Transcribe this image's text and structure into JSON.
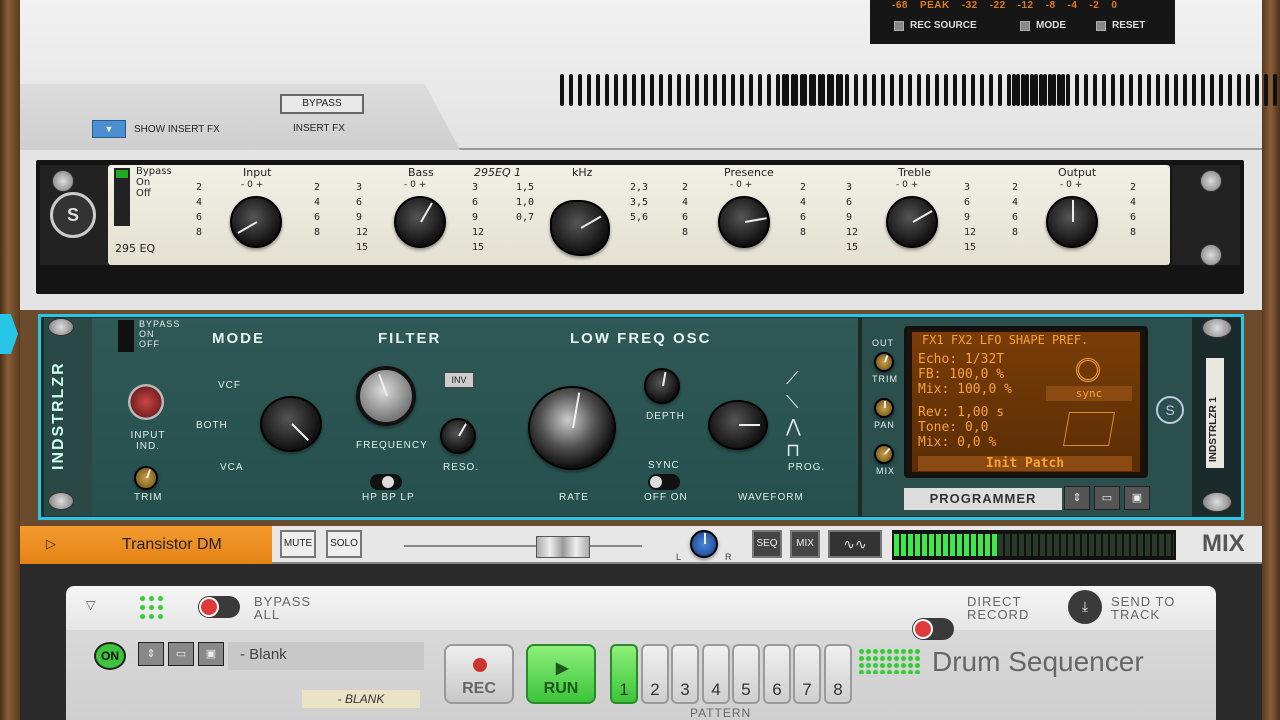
{
  "top_device": {
    "meter_scale": [
      "-68",
      "PEAK",
      "-32",
      "-22",
      "-12",
      "-8",
      "-4",
      "-2",
      "0"
    ],
    "rec_source_label": "REC SOURCE",
    "mode_label": "MODE",
    "reset_label": "RESET",
    "bypass_label": "BYPASS",
    "insert_fx_label": "INSERT FX",
    "show_insert_fx_label": "SHOW INSERT FX"
  },
  "eq": {
    "name": "295 EQ",
    "patch_note": "295EQ 1",
    "bypass_labels": [
      "Bypass",
      "On",
      "Off"
    ],
    "knobs": [
      {
        "label": "Input",
        "top": "- 0 +",
        "left": [
          "2",
          "4",
          "6",
          "8"
        ],
        "right": [
          "2",
          "4",
          "6",
          "8"
        ]
      },
      {
        "label": "Bass",
        "top": "- 0 +",
        "left": [
          "3",
          "6",
          "9",
          "12",
          "15"
        ],
        "right": [
          "3",
          "6",
          "9",
          "12",
          "15"
        ]
      },
      {
        "label": "kHz",
        "top": "",
        "left": [
          "1,5",
          "1,0",
          "0,7"
        ],
        "right": [
          "2,3",
          "3,5",
          "5,6"
        ]
      },
      {
        "label": "Presence",
        "top": "- 0 +",
        "left": [
          "2",
          "4",
          "6",
          "8"
        ],
        "right": [
          "2",
          "4",
          "6",
          "8"
        ]
      },
      {
        "label": "Treble",
        "top": "- 0 +",
        "left": [
          "3",
          "6",
          "9",
          "12",
          "15"
        ],
        "right": [
          "3",
          "6",
          "9",
          "12",
          "15"
        ]
      },
      {
        "label": "Output",
        "top": "- 0 +",
        "left": [
          "2",
          "4",
          "6",
          "8"
        ],
        "right": [
          "2",
          "4",
          "6",
          "8"
        ]
      }
    ]
  },
  "indstrlzr": {
    "side_title": "INDSTRLZR",
    "bypass_labels": [
      "BYPASS",
      "ON",
      "OFF"
    ],
    "mode": "MODE",
    "filter": "FILTER",
    "lfo": "LOW FREQ OSC",
    "vcf": "VCF",
    "both": "BOTH",
    "vca": "VCA",
    "input_ind": "INPUT IND.",
    "trim": "TRIM",
    "inv": "INV",
    "frequency": "FREQUENCY",
    "reso": "RESO.",
    "hp_bp_lp": "HP BP LP",
    "rate": "RATE",
    "depth": "DEPTH",
    "sync": "SYNC",
    "off_on": "OFF ON",
    "waveform": "WAVEFORM",
    "prog": "PROG.",
    "out": "OUT",
    "trim2": "TRIM",
    "pan": "PAN",
    "mix": "MIX",
    "programmer": "PROGRAMMER",
    "right_title": "INDSTRLZR 1",
    "lcd": {
      "header": "FX1 FX2 LFO SHAPE PREF.",
      "echo": "Echo:  1/32T",
      "fb": "FB:   100,0 %",
      "mix1": "Mix:  100,0 %",
      "sync": "sync",
      "rev": "Rev:  1,00 s",
      "tone": "Tone:  0,0",
      "mix2": "Mix:   0,0 %",
      "patch": "Init Patch"
    }
  },
  "mixstrip": {
    "track_name": "Transistor DM",
    "mute": "MUTE",
    "solo": "SOLO",
    "pan_l": "L",
    "pan_r": "R",
    "seq": "SEQ",
    "mix": "MIX",
    "mix_big": "MIX"
  },
  "drum": {
    "bypass_all": "BYPASS ALL",
    "direct_record": "DIRECT RECORD",
    "send_to_track": "SEND TO TRACK",
    "on": "ON",
    "patch_name": "- Blank",
    "tape_label": "- BLANK",
    "rec": "REC",
    "run": "RUN",
    "patterns": [
      "1",
      "2",
      "3",
      "4",
      "5",
      "6",
      "7",
      "8"
    ],
    "pattern_label": "PATTERN",
    "title": "Drum Sequencer",
    "colors": {
      "run": "#3cc43a",
      "rec_dot": "#c33"
    }
  }
}
